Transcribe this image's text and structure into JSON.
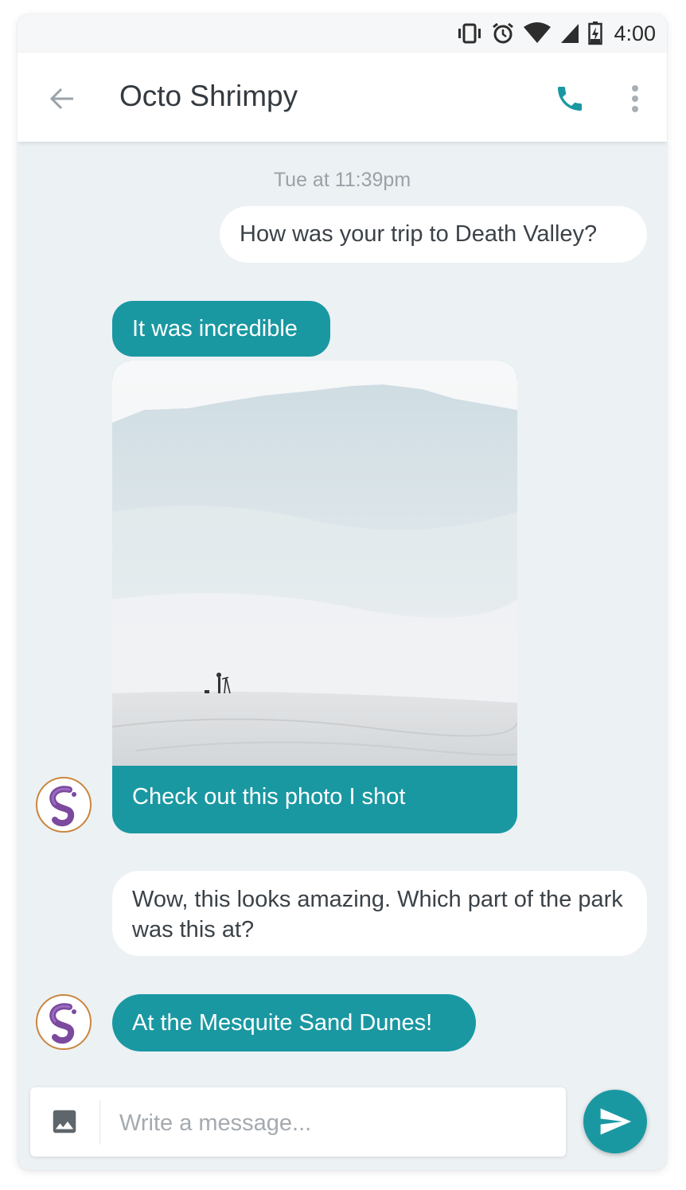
{
  "status_bar": {
    "time": "4:00",
    "icons": [
      "vibrate-icon",
      "alarm-icon",
      "wifi-icon",
      "signal-icon",
      "battery-charging-icon"
    ]
  },
  "app_bar": {
    "back_icon": "arrow-back-icon",
    "title": "Octo Shrimpy",
    "call_icon": "phone-icon",
    "more_icon": "more-vert-icon"
  },
  "conversation": {
    "timestamp": "Tue at 11:39pm",
    "messages": [
      {
        "direction": "outgoing",
        "text": "How was your trip to Death Valley?"
      },
      {
        "direction": "incoming",
        "text": "It was incredible"
      },
      {
        "direction": "incoming",
        "type": "photo",
        "caption": "Check out this photo I shot"
      },
      {
        "direction": "outgoing",
        "text": "Wow, this looks amazing. Which part of the park was this at?"
      },
      {
        "direction": "incoming",
        "text": "At the Mesquite Sand Dunes!"
      }
    ]
  },
  "composer": {
    "image_icon": "image-icon",
    "placeholder": "Write a message...",
    "value": "",
    "send_icon": "send-icon"
  },
  "colors": {
    "accent": "#1a98a2",
    "background": "#ecf1f4",
    "outgoing_bubble": "#ffffff"
  }
}
